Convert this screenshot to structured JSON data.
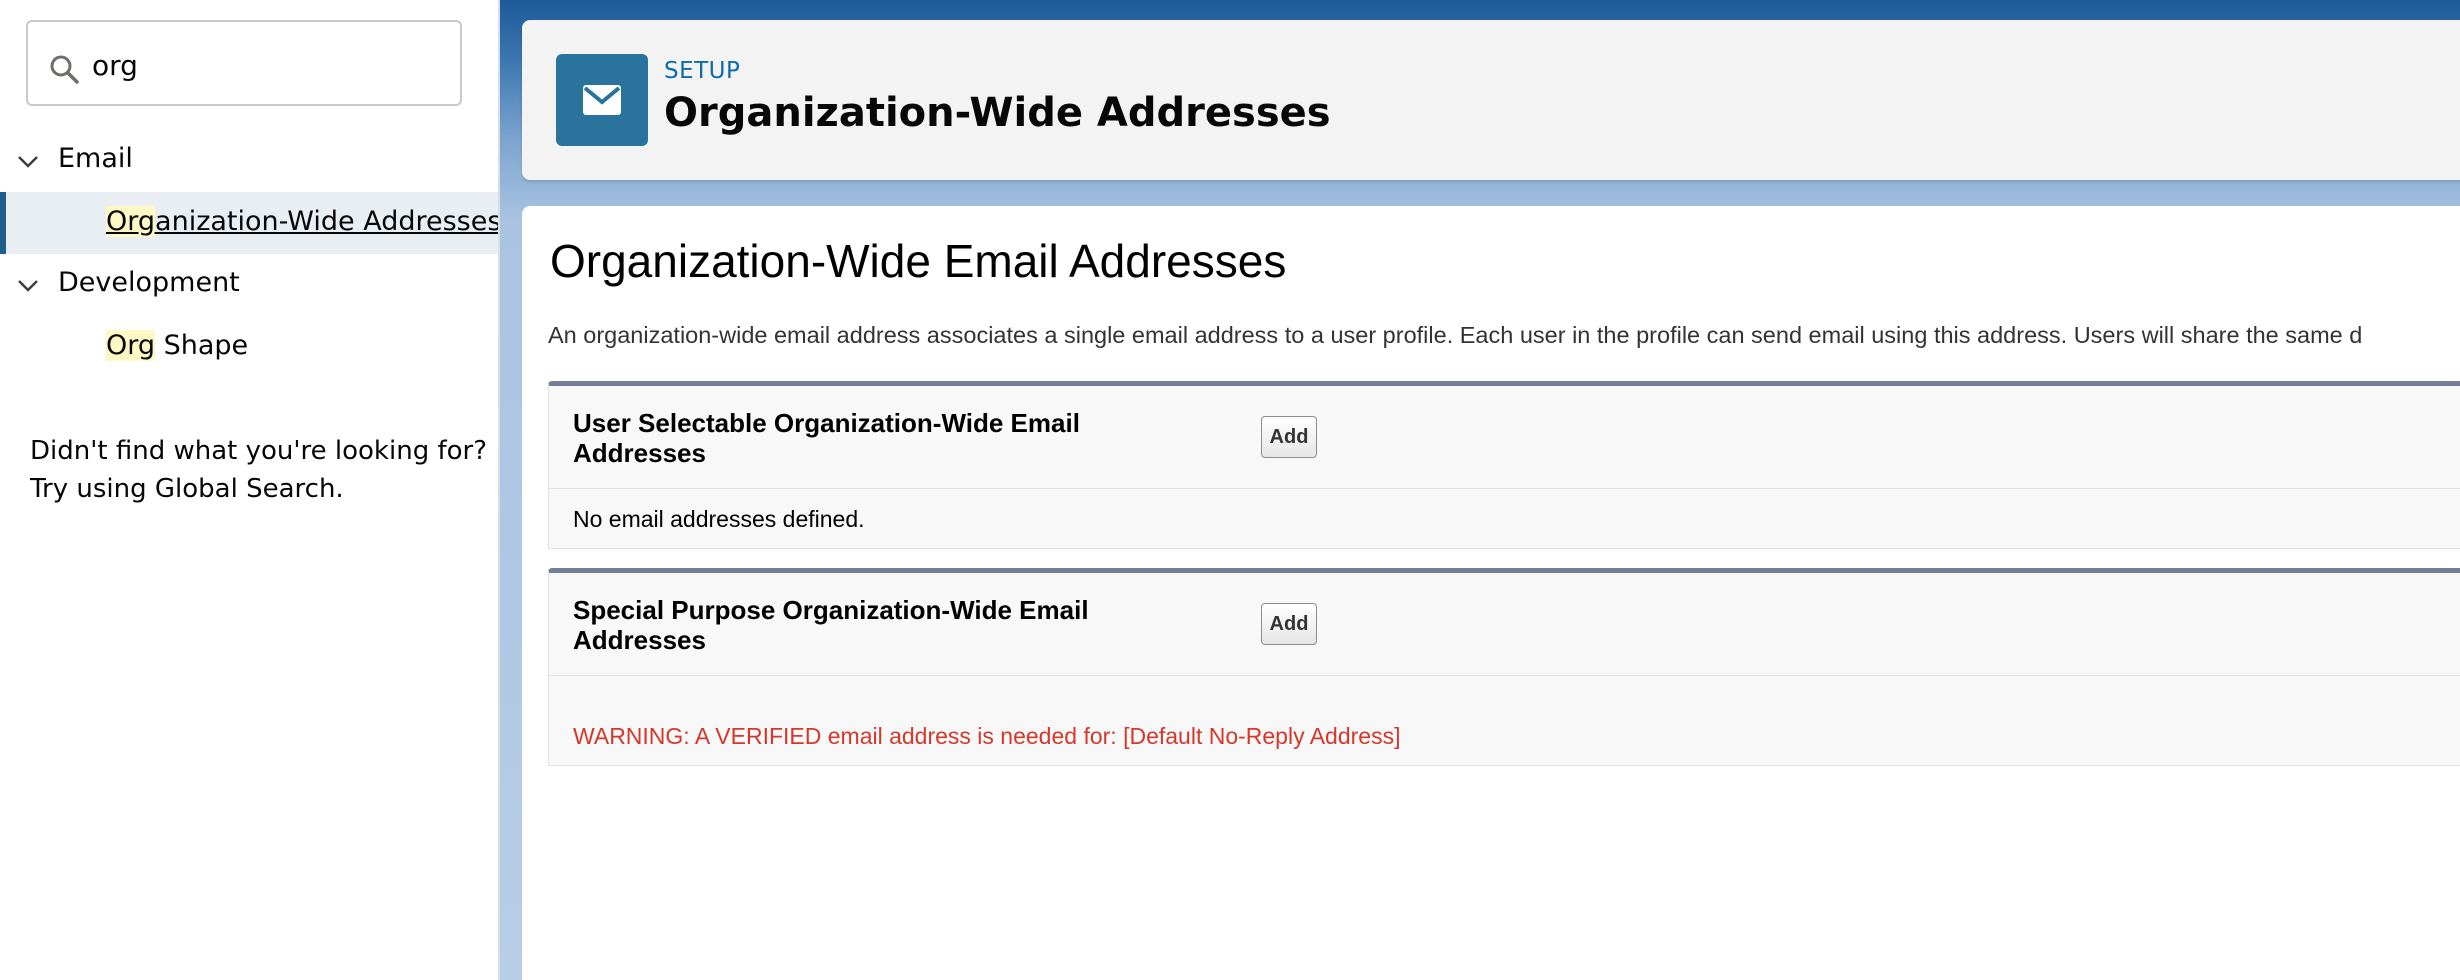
{
  "search": {
    "value": "org"
  },
  "sidebar": {
    "groups": [
      {
        "label": "Email",
        "items": [
          {
            "highlight": "Org",
            "rest": "anization-Wide Addresses",
            "selected": true
          }
        ]
      },
      {
        "label": "Development",
        "items": [
          {
            "highlight": "Org",
            "rest": " Shape",
            "selected": false
          }
        ]
      }
    ],
    "help_line1": "Didn't find what you're looking for?",
    "help_line2": "Try using Global Search."
  },
  "header": {
    "eyebrow": "SETUP",
    "title": "Organization-Wide Addresses",
    "icon": "email-icon"
  },
  "main": {
    "heading": "Organization-Wide Email Addresses",
    "description": "An organization-wide email address associates a single email address to a user profile. Each user in the profile can send email using this address. Users will share the same d",
    "sections": [
      {
        "title": "User Selectable Organization-Wide Email Addresses",
        "add_label": "Add",
        "body": "No email addresses defined."
      },
      {
        "title": "Special Purpose Organization-Wide Email Addresses",
        "add_label": "Add",
        "body": "WARNING: A VERIFIED email address is needed for: [Default No-Reply Address]"
      }
    ]
  },
  "colors": {
    "header_icon_bg": "#2a739d",
    "selected_accent": "#1b5f8a",
    "warning_text": "#d3392b",
    "highlight": "#fdf8c4"
  }
}
